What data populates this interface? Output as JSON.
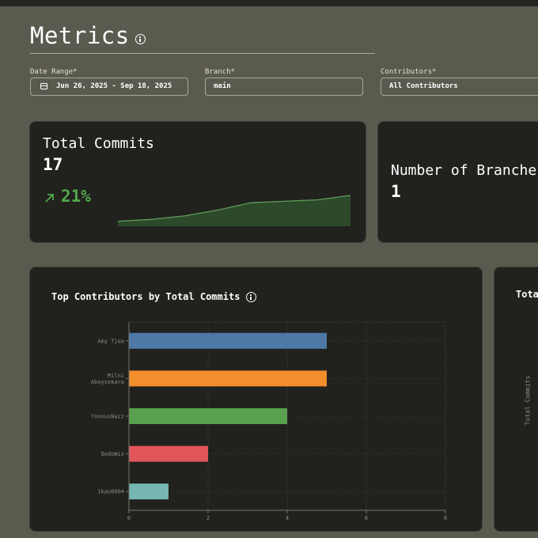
{
  "header": {
    "title": "Metrics",
    "info_icon": "info-icon"
  },
  "filters": {
    "date_range": {
      "label": "Date Range*",
      "value": "Jun 26, 2025 - Sep 18, 2025",
      "icon": "calendar-icon"
    },
    "branch": {
      "label": "Branch*",
      "value": "main"
    },
    "contributors": {
      "label": "Contributors*",
      "value": "All Contributors"
    }
  },
  "stats": {
    "total_commits": {
      "label": "Total Commits",
      "value": "17",
      "trend": "21%",
      "trend_direction": "up",
      "trend_color": "#52a84a"
    },
    "branches": {
      "label": "Number of Branches",
      "value": "1"
    }
  },
  "sparkline": {
    "values": [
      0.12,
      0.18,
      0.3,
      0.5,
      0.75,
      0.8,
      0.85,
      1.0
    ],
    "fill": "#2c4a2a",
    "stroke": "#5f9c58"
  },
  "top_contributors": {
    "title": "Top Contributors by Total Commits"
  },
  "second_chart": {
    "title": "Tota",
    "ylabel": "Total Commits"
  },
  "chart_data": {
    "type": "bar",
    "orientation": "horizontal",
    "title": "Top Contributors by Total Commits",
    "categories": [
      "Amy Tjea",
      "Milni Aboysekara",
      "YoonusNazz",
      "QodoWiz",
      "ikau0004"
    ],
    "category_lines": [
      [
        "Amy Tjea"
      ],
      [
        "Milni",
        "Aboysekara"
      ],
      [
        "YoonusNazz"
      ],
      [
        "QodoWiz"
      ],
      [
        "ikau0004"
      ]
    ],
    "values": [
      5,
      5,
      4,
      2,
      1
    ],
    "colors": [
      "#4e79a7",
      "#f28e2b",
      "#59a14f",
      "#e15759",
      "#76b7b2"
    ],
    "xlim": [
      0,
      8
    ],
    "xticks": [
      "0",
      "2",
      "4",
      "6",
      "8"
    ],
    "grid": true
  }
}
